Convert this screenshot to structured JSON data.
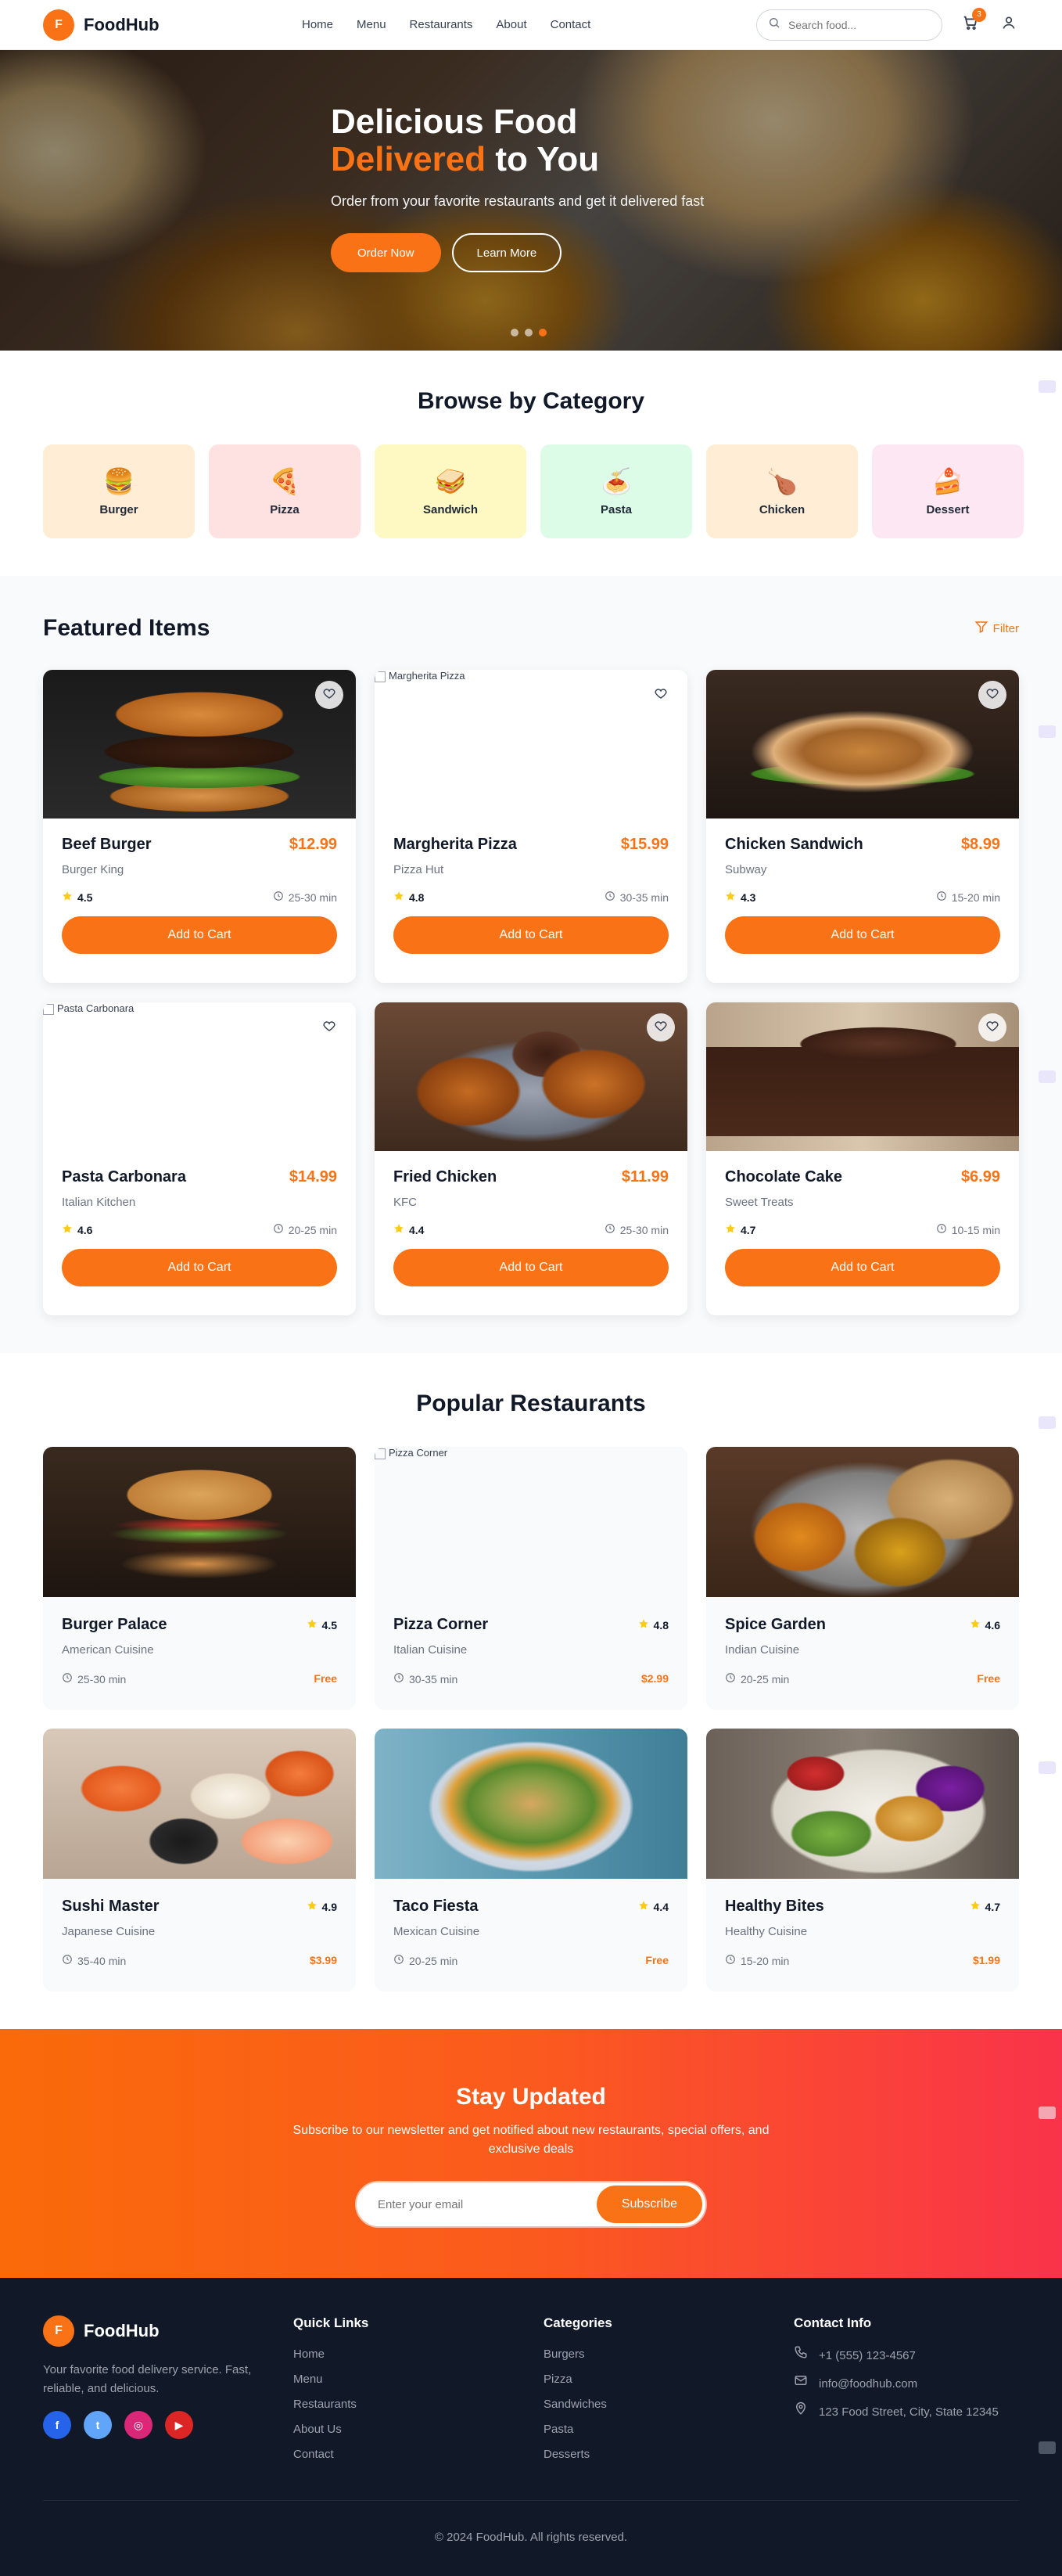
{
  "brand": {
    "logo_letter": "F",
    "name": "FoodHub",
    "accent": "#f97316"
  },
  "nav": {
    "links": [
      "Home",
      "Menu",
      "Restaurants",
      "About",
      "Contact"
    ],
    "search_placeholder": "Search food...",
    "cart_count": "3",
    "icons": [
      "search-icon",
      "cart-icon",
      "user-icon"
    ]
  },
  "hero": {
    "title_line1": "Delicious Food",
    "title_accent": "Delivered",
    "title_rest": " to You",
    "subtitle": "Order from your favorite restaurants and get it delivered fast",
    "primary_btn": "Order Now",
    "secondary_btn": "Learn More",
    "slide_count": 3,
    "active_slide": 3
  },
  "categories": {
    "title": "Browse by Category",
    "items": [
      {
        "label": "Burger",
        "emoji": "🍔",
        "bg": "#ffedd5"
      },
      {
        "label": "Pizza",
        "emoji": "🍕",
        "bg": "#fee2e2"
      },
      {
        "label": "Sandwich",
        "emoji": "🥪",
        "bg": "#fef9c3"
      },
      {
        "label": "Pasta",
        "emoji": "🍝",
        "bg": "#dcfce7"
      },
      {
        "label": "Chicken",
        "emoji": "🍗",
        "bg": "#ffedd5"
      },
      {
        "label": "Dessert",
        "emoji": "🍰",
        "bg": "#fce7f3"
      }
    ]
  },
  "featured": {
    "title": "Featured Items",
    "filter_label": "Filter",
    "add_label": "Add to Cart",
    "items": [
      {
        "name": "Beef Burger",
        "price": "$12.99",
        "restaurant": "Burger King",
        "rating": "4.5",
        "time": "25-30 min",
        "image": "burger",
        "alt": ""
      },
      {
        "name": "Margherita Pizza",
        "price": "$15.99",
        "restaurant": "Pizza Hut",
        "rating": "4.8",
        "time": "30-35 min",
        "image": "broken",
        "alt": "Margherita Pizza"
      },
      {
        "name": "Chicken Sandwich",
        "price": "$8.99",
        "restaurant": "Subway",
        "rating": "4.3",
        "time": "15-20 min",
        "image": "sandwich",
        "alt": ""
      },
      {
        "name": "Pasta Carbonara",
        "price": "$14.99",
        "restaurant": "Italian Kitchen",
        "rating": "4.6",
        "time": "20-25 min",
        "image": "broken",
        "alt": "Pasta Carbonara"
      },
      {
        "name": "Fried Chicken",
        "price": "$11.99",
        "restaurant": "KFC",
        "rating": "4.4",
        "time": "25-30 min",
        "image": "chicken",
        "alt": ""
      },
      {
        "name": "Chocolate Cake",
        "price": "$6.99",
        "restaurant": "Sweet Treats",
        "rating": "4.7",
        "time": "10-15 min",
        "image": "cake",
        "alt": ""
      }
    ]
  },
  "restaurants": {
    "title": "Popular Restaurants",
    "items": [
      {
        "name": "Burger Palace",
        "cuisine": "American Cuisine",
        "rating": "4.5",
        "time": "25-30 min",
        "fee": "Free",
        "image": "burger2",
        "alt": ""
      },
      {
        "name": "Pizza Corner",
        "cuisine": "Italian Cuisine",
        "rating": "4.8",
        "time": "30-35 min",
        "fee": "$2.99",
        "image": "broken",
        "alt": "Pizza Corner"
      },
      {
        "name": "Spice Garden",
        "cuisine": "Indian Cuisine",
        "rating": "4.6",
        "time": "20-25 min",
        "fee": "Free",
        "image": "indian",
        "alt": ""
      },
      {
        "name": "Sushi Master",
        "cuisine": "Japanese Cuisine",
        "rating": "4.9",
        "time": "35-40 min",
        "fee": "$3.99",
        "image": "sushi",
        "alt": ""
      },
      {
        "name": "Taco Fiesta",
        "cuisine": "Mexican Cuisine",
        "rating": "4.4",
        "time": "20-25 min",
        "fee": "Free",
        "image": "taco",
        "alt": ""
      },
      {
        "name": "Healthy Bites",
        "cuisine": "Healthy Cuisine",
        "rating": "4.7",
        "time": "15-20 min",
        "fee": "$1.99",
        "image": "salad",
        "alt": ""
      }
    ]
  },
  "newsletter": {
    "title": "Stay Updated",
    "text": "Subscribe to our newsletter and get notified about new restaurants, special offers, and exclusive deals",
    "placeholder": "Enter your email",
    "button": "Subscribe"
  },
  "footer": {
    "description": "Your favorite food delivery service. Fast, reliable, and delicious.",
    "socials": [
      {
        "name": "facebook-icon",
        "glyph": "f",
        "color": "#2563eb"
      },
      {
        "name": "twitter-icon",
        "glyph": "t",
        "color": "#60a5fa"
      },
      {
        "name": "instagram-icon",
        "glyph": "◎",
        "color": "#db2777"
      },
      {
        "name": "youtube-icon",
        "glyph": "▶",
        "color": "#dc2626"
      }
    ],
    "quick_links_title": "Quick Links",
    "quick_links": [
      "Home",
      "Menu",
      "Restaurants",
      "About Us",
      "Contact"
    ],
    "categories_title": "Categories",
    "categories": [
      "Burgers",
      "Pizza",
      "Sandwiches",
      "Pasta",
      "Desserts"
    ],
    "contact_title": "Contact Info",
    "contact": [
      {
        "icon": "phone-icon",
        "text": "+1 (555) 123-4567"
      },
      {
        "icon": "mail-icon",
        "text": "info@foodhub.com"
      },
      {
        "icon": "location-icon",
        "text": "123 Food Street, City, State 12345"
      }
    ],
    "copyright": "© 2024 FoodHub. All rights reserved."
  }
}
